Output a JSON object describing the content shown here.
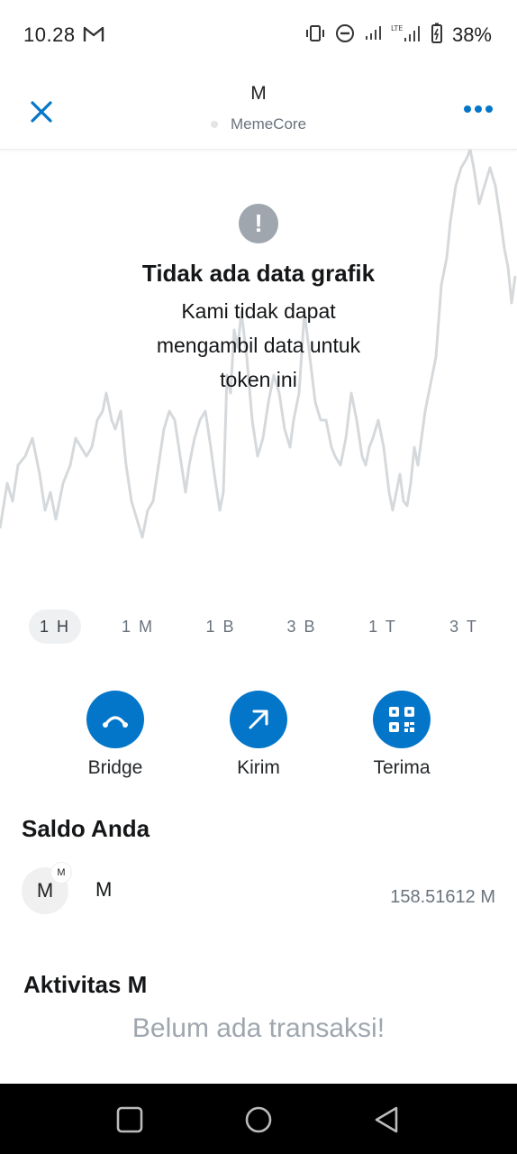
{
  "status_bar": {
    "time": "10.28",
    "battery": "38%",
    "icons": [
      "gmail-icon",
      "vibrate-icon",
      "do-not-disturb-icon",
      "signal-icon",
      "lte-signal-icon",
      "battery-charging-icon"
    ]
  },
  "header": {
    "token_symbol": "M",
    "network_name": "MemeCore",
    "close_icon": "close-icon",
    "more_icon": "more-icon"
  },
  "chart": {
    "no_data_icon": "warning-icon",
    "no_data_title": "Tidak ada data grafik",
    "no_data_message": "Kami tidak dapat mengambil data untuk token ini"
  },
  "periods": {
    "selected": "1 H",
    "options": [
      "1 H",
      "1 M",
      "1 B",
      "3 B",
      "1 T",
      "3 T"
    ]
  },
  "actions": [
    {
      "label": "Bridge",
      "icon": "bridge-icon"
    },
    {
      "label": "Kirim",
      "icon": "arrow-up-right-icon"
    },
    {
      "label": "Terima",
      "icon": "qr-code-icon"
    }
  ],
  "balance": {
    "title": "Saldo Anda",
    "token_avatar": "M",
    "token_badge": "M",
    "token_name": "M",
    "amount": "158.51612 M"
  },
  "activity": {
    "title": "Aktivitas M",
    "empty_message": "Belum ada transaksi!"
  },
  "colors": {
    "accent": "#0376c9",
    "muted_text": "#6a737d",
    "chart_line": "#d6d9dc"
  },
  "nav_bar": {
    "icons": [
      "recents-icon",
      "home-icon",
      "back-icon"
    ]
  }
}
